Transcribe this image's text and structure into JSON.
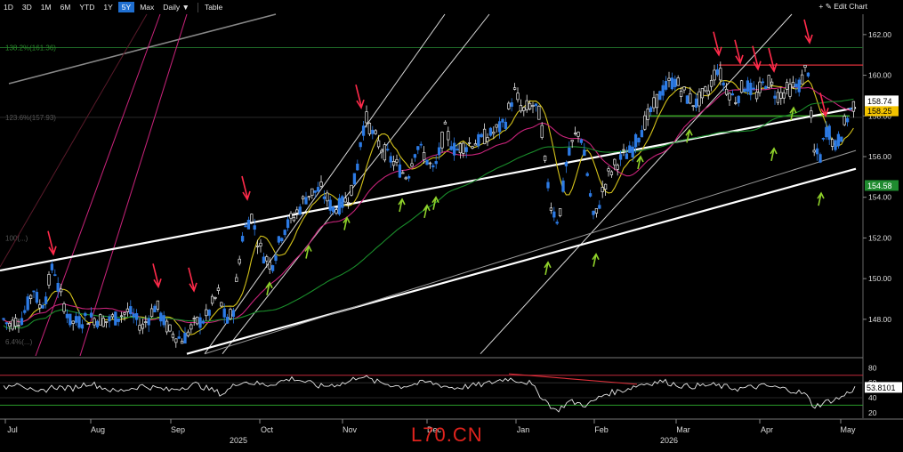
{
  "toolbar": {
    "timeframes": [
      "1D",
      "3D",
      "1M",
      "6M",
      "YTD",
      "1Y",
      "5Y",
      "Max"
    ],
    "active": "5Y",
    "interval": "Daily",
    "table_label": "Table",
    "edit_label": "Edit Chart"
  },
  "watermark": "L70.CN",
  "colors": {
    "up": "#e8e8e8",
    "down": "#2c7be5",
    "ma_fast": "#d4c21a",
    "ma_mid": "#c8237a",
    "ma_slow": "#1a8d2b",
    "trend": "#ffffff",
    "arrow_red": "#ff2a4a",
    "arrow_green": "#8fd12a",
    "last_price_bg": "#ffffff",
    "ma_fast_tag_bg": "#f2c200",
    "ma_slow_tag_bg": "#1f8b2f"
  },
  "chart_data": {
    "type": "candlestick",
    "x_ticks": [
      "Jul",
      "Aug",
      "Sep",
      "Oct",
      "Nov",
      "Dec",
      "Jan",
      "Feb",
      "Mar",
      "Apr",
      "May"
    ],
    "year_labels": [
      "2025",
      "2026"
    ],
    "y_ticks": [
      148.0,
      150.0,
      152.0,
      154.0,
      156.0,
      158.0,
      160.0,
      162.0
    ],
    "ylim": [
      146.2,
      163.0
    ],
    "last_price": 158.74,
    "ma_fast_value": 158.25,
    "ma_slow_value": 154.58,
    "fib_labels": [
      "138.2%(161.36)",
      "123.6%(157.93)",
      "100(...)",
      "6.4%(...)"
    ],
    "fib_levels": [
      161.36,
      157.93
    ],
    "price_path": [
      [
        0,
        148.2
      ],
      [
        10,
        147.7
      ],
      [
        25,
        148.1
      ],
      [
        38,
        149.5
      ],
      [
        45,
        148.6
      ],
      [
        52,
        149.2
      ],
      [
        60,
        150.8
      ],
      [
        66,
        149.4
      ],
      [
        80,
        147.8
      ],
      [
        100,
        148.1
      ],
      [
        120,
        147.9
      ],
      [
        145,
        148.4
      ],
      [
        160,
        147.6
      ],
      [
        175,
        148.7
      ],
      [
        190,
        147.4
      ],
      [
        205,
        147.0
      ],
      [
        220,
        147.8
      ],
      [
        232,
        148.1
      ],
      [
        245,
        149.3
      ],
      [
        255,
        147.8
      ],
      [
        262,
        148.4
      ],
      [
        272,
        152.0
      ],
      [
        282,
        153.2
      ],
      [
        292,
        151.5
      ],
      [
        305,
        150.6
      ],
      [
        318,
        152.4
      ],
      [
        330,
        153.0
      ],
      [
        345,
        154.1
      ],
      [
        360,
        154.4
      ],
      [
        375,
        153.4
      ],
      [
        390,
        153.9
      ],
      [
        400,
        155.0
      ],
      [
        407,
        157.3
      ],
      [
        412,
        157.8
      ],
      [
        420,
        157.0
      ],
      [
        432,
        156.2
      ],
      [
        445,
        155.6
      ],
      [
        458,
        155.0
      ],
      [
        468,
        156.6
      ],
      [
        478,
        156.0
      ],
      [
        488,
        155.2
      ],
      [
        500,
        157.3
      ],
      [
        512,
        156.3
      ],
      [
        525,
        156.6
      ],
      [
        540,
        156.8
      ],
      [
        555,
        157.2
      ],
      [
        567,
        157.6
      ],
      [
        578,
        159.2
      ],
      [
        588,
        158.2
      ],
      [
        598,
        158.6
      ],
      [
        608,
        157.9
      ],
      [
        612,
        155.8
      ],
      [
        620,
        153.5
      ],
      [
        628,
        152.8
      ],
      [
        636,
        155.5
      ],
      [
        645,
        156.9
      ],
      [
        652,
        157.3
      ],
      [
        660,
        155.2
      ],
      [
        668,
        152.7
      ],
      [
        675,
        154.0
      ],
      [
        683,
        155.0
      ],
      [
        692,
        155.6
      ],
      [
        700,
        156.0
      ],
      [
        710,
        156.3
      ],
      [
        720,
        157.3
      ],
      [
        732,
        158.2
      ],
      [
        745,
        159.3
      ],
      [
        758,
        159.8
      ],
      [
        770,
        159.0
      ],
      [
        782,
        158.6
      ],
      [
        796,
        159.2
      ],
      [
        806,
        160.4
      ],
      [
        815,
        159.4
      ],
      [
        826,
        158.8
      ],
      [
        838,
        159.6
      ],
      [
        850,
        159.0
      ],
      [
        862,
        159.8
      ],
      [
        874,
        159.0
      ],
      [
        888,
        159.3
      ],
      [
        900,
        159.6
      ],
      [
        908,
        160.6
      ],
      [
        914,
        156.2
      ],
      [
        922,
        156.0
      ],
      [
        930,
        157.6
      ],
      [
        938,
        156.4
      ],
      [
        946,
        157.2
      ],
      [
        955,
        158.2
      ],
      [
        962,
        158.7
      ]
    ],
    "osc_ticks": [
      80,
      60,
      40,
      20
    ],
    "osc_last": 53.8101,
    "osc_lim": [
      15,
      90
    ],
    "osc_path": [
      [
        0,
        50
      ],
      [
        20,
        62
      ],
      [
        40,
        45
      ],
      [
        60,
        55
      ],
      [
        80,
        52
      ],
      [
        100,
        60
      ],
      [
        130,
        48
      ],
      [
        160,
        56
      ],
      [
        190,
        50
      ],
      [
        220,
        58
      ],
      [
        250,
        45
      ],
      [
        270,
        62
      ],
      [
        300,
        57
      ],
      [
        330,
        66
      ],
      [
        360,
        55
      ],
      [
        390,
        60
      ],
      [
        405,
        70
      ],
      [
        420,
        62
      ],
      [
        450,
        55
      ],
      [
        480,
        61
      ],
      [
        510,
        53
      ],
      [
        545,
        58
      ],
      [
        570,
        66
      ],
      [
        595,
        60
      ],
      [
        610,
        40
      ],
      [
        625,
        22
      ],
      [
        640,
        35
      ],
      [
        660,
        30
      ],
      [
        680,
        45
      ],
      [
        700,
        50
      ],
      [
        720,
        58
      ],
      [
        745,
        62
      ],
      [
        770,
        55
      ],
      [
        800,
        57
      ],
      [
        830,
        52
      ],
      [
        860,
        56
      ],
      [
        890,
        50
      ],
      [
        905,
        45
      ],
      [
        915,
        28
      ],
      [
        930,
        35
      ],
      [
        945,
        40
      ],
      [
        962,
        53.8
      ]
    ],
    "trendlines": [
      {
        "kind": "up_channel_main",
        "from": [
          0,
          150.4
        ],
        "to": [
          962,
          158.4
        ]
      },
      {
        "kind": "up_channel_lower",
        "from": [
          210,
          146.3
        ],
        "to": [
          962,
          155.4
        ]
      },
      {
        "kind": "steep_up_a",
        "from": [
          230,
          146.3
        ],
        "to": [
          500,
          163
        ]
      },
      {
        "kind": "steep_up_b",
        "from": [
          250,
          146.3
        ],
        "to": [
          550,
          163
        ]
      },
      {
        "kind": "steep_up_c",
        "from": [
          540,
          146.3
        ],
        "to": [
          890,
          163
        ]
      }
    ],
    "arrows_red": [
      [
        60,
        151.2
      ],
      [
        178,
        149.6
      ],
      [
        218,
        149.4
      ],
      [
        278,
        153.9
      ],
      [
        406,
        158.4
      ],
      [
        808,
        161.0
      ],
      [
        832,
        160.6
      ],
      [
        852,
        160.3
      ],
      [
        870,
        160.2
      ],
      [
        910,
        161.6
      ],
      [
        928,
        158.0
      ]
    ],
    "arrows_green": [
      [
        303,
        149.8
      ],
      [
        347,
        151.6
      ],
      [
        390,
        153.0
      ],
      [
        452,
        153.9
      ],
      [
        480,
        153.6
      ],
      [
        490,
        154.0
      ],
      [
        616,
        150.8
      ],
      [
        670,
        151.2
      ],
      [
        720,
        156.0
      ],
      [
        775,
        157.3
      ],
      [
        870,
        156.4
      ],
      [
        892,
        158.4
      ],
      [
        923,
        154.2
      ]
    ]
  }
}
